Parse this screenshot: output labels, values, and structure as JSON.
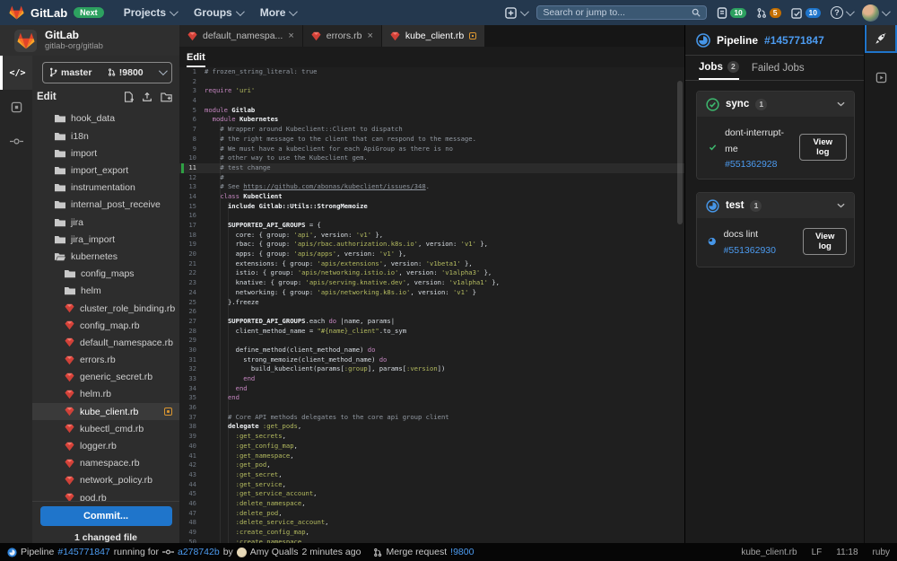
{
  "colors": {
    "blue": "#1f75cb",
    "link": "#4c9bf0",
    "green": "#2da160",
    "success": "#3db96f",
    "running": "#4696e8",
    "orange_badge": "#c26e00",
    "modified": "#d99530",
    "ruby": "#e2453c"
  },
  "navbar": {
    "brand": "GitLab",
    "next_badge": "Next",
    "menus": [
      {
        "label": "Projects"
      },
      {
        "label": "Groups"
      },
      {
        "label": "More"
      }
    ],
    "search": {
      "placeholder": "Search or jump to..."
    },
    "counters": {
      "issues": "10",
      "merge_requests": "5",
      "todos": "10"
    },
    "help": "?"
  },
  "project": {
    "name": "GitLab",
    "path": "gitlab-org/gitlab"
  },
  "branch_bar": {
    "branch": "master",
    "mr": "!9800"
  },
  "explorer": {
    "header": "Edit",
    "commit_label": "Commit...",
    "changed_label": "1 changed file",
    "items": [
      {
        "name": "hook_data",
        "type": "folder",
        "depth": 1
      },
      {
        "name": "i18n",
        "type": "folder",
        "depth": 1
      },
      {
        "name": "import",
        "type": "folder",
        "depth": 1
      },
      {
        "name": "import_export",
        "type": "folder",
        "depth": 1
      },
      {
        "name": "instrumentation",
        "type": "folder",
        "depth": 1
      },
      {
        "name": "internal_post_receive",
        "type": "folder",
        "depth": 1
      },
      {
        "name": "jira",
        "type": "folder",
        "depth": 1
      },
      {
        "name": "jira_import",
        "type": "folder",
        "depth": 1
      },
      {
        "name": "kubernetes",
        "type": "folder-open",
        "depth": 1
      },
      {
        "name": "config_maps",
        "type": "folder",
        "depth": 2
      },
      {
        "name": "helm",
        "type": "folder",
        "depth": 2
      },
      {
        "name": "cluster_role_binding.rb",
        "type": "ruby",
        "depth": 2
      },
      {
        "name": "config_map.rb",
        "type": "ruby",
        "depth": 2
      },
      {
        "name": "default_namespace.rb",
        "type": "ruby",
        "depth": 2
      },
      {
        "name": "errors.rb",
        "type": "ruby",
        "depth": 2
      },
      {
        "name": "generic_secret.rb",
        "type": "ruby",
        "depth": 2
      },
      {
        "name": "helm.rb",
        "type": "ruby",
        "depth": 2
      },
      {
        "name": "kube_client.rb",
        "type": "ruby",
        "depth": 2,
        "selected": true,
        "modified": true
      },
      {
        "name": "kubectl_cmd.rb",
        "type": "ruby",
        "depth": 2
      },
      {
        "name": "logger.rb",
        "type": "ruby",
        "depth": 2
      },
      {
        "name": "namespace.rb",
        "type": "ruby",
        "depth": 2
      },
      {
        "name": "network_policy.rb",
        "type": "ruby",
        "depth": 2
      },
      {
        "name": "pod.rb",
        "type": "ruby",
        "depth": 2
      }
    ]
  },
  "tabs": [
    {
      "label": "default_namespa...",
      "close": true,
      "active": false
    },
    {
      "label": "errors.rb",
      "close": true,
      "active": false
    },
    {
      "label": "kube_client.rb",
      "modified": true,
      "active": true
    }
  ],
  "editor": {
    "mode_tab": "Edit",
    "current_line": 11,
    "changed_lines": [
      11
    ],
    "lines": [
      [
        [
          "c",
          "# frozen_string_literal: true"
        ]
      ],
      [],
      [
        [
          "k",
          "require"
        ],
        [
          "p",
          " "
        ],
        [
          "s",
          "'uri'"
        ]
      ],
      [],
      [
        [
          "k",
          "module"
        ],
        [
          "p",
          " "
        ],
        [
          "b",
          "Gitlab"
        ]
      ],
      [
        [
          "p",
          "  "
        ],
        [
          "k",
          "module"
        ],
        [
          "p",
          " "
        ],
        [
          "b",
          "Kubernetes"
        ]
      ],
      [
        [
          "p",
          "    "
        ],
        [
          "c",
          "# Wrapper around Kubeclient::Client to dispatch"
        ]
      ],
      [
        [
          "p",
          "    "
        ],
        [
          "c",
          "# the right message to the client that can respond to the message."
        ]
      ],
      [
        [
          "p",
          "    "
        ],
        [
          "c",
          "# We must have a kubeclient for each ApiGroup as there is no"
        ]
      ],
      [
        [
          "p",
          "    "
        ],
        [
          "c",
          "# other way to use the Kubeclient gem."
        ]
      ],
      [
        [
          "p",
          "    "
        ],
        [
          "c",
          "# test change"
        ]
      ],
      [
        [
          "p",
          "    "
        ],
        [
          "c",
          "#"
        ]
      ],
      [
        [
          "p",
          "    "
        ],
        [
          "c",
          "# See "
        ],
        [
          "cu",
          "https://github.com/abonas/kubeclient/issues/348"
        ],
        [
          "c",
          "."
        ]
      ],
      [
        [
          "p",
          "    "
        ],
        [
          "k",
          "class"
        ],
        [
          "p",
          " "
        ],
        [
          "b",
          "KubeClient"
        ]
      ],
      [
        [
          "p",
          "      "
        ],
        [
          "b",
          "include"
        ],
        [
          "p",
          " "
        ],
        [
          "b",
          "Gitlab::Utils::StrongMemoize"
        ]
      ],
      [],
      [
        [
          "p",
          "      "
        ],
        [
          "b",
          "SUPPORTED_API_GROUPS"
        ],
        [
          "p",
          " = {"
        ]
      ],
      [
        [
          "p",
          "        core: { group: "
        ],
        [
          "s",
          "'api'"
        ],
        [
          "p",
          ", version: "
        ],
        [
          "s",
          "'v1'"
        ],
        [
          "p",
          " },"
        ]
      ],
      [
        [
          "p",
          "        rbac: { group: "
        ],
        [
          "s",
          "'apis/rbac.authorization.k8s.io'"
        ],
        [
          "p",
          ", version: "
        ],
        [
          "s",
          "'v1'"
        ],
        [
          "p",
          " },"
        ]
      ],
      [
        [
          "p",
          "        apps: { group: "
        ],
        [
          "s",
          "'apis/apps'"
        ],
        [
          "p",
          ", version: "
        ],
        [
          "s",
          "'v1'"
        ],
        [
          "p",
          " },"
        ]
      ],
      [
        [
          "p",
          "        extensions: { group: "
        ],
        [
          "s",
          "'apis/extensions'"
        ],
        [
          "p",
          ", version: "
        ],
        [
          "s",
          "'v1beta1'"
        ],
        [
          "p",
          " },"
        ]
      ],
      [
        [
          "p",
          "        istio: { group: "
        ],
        [
          "s",
          "'apis/networking.istio.io'"
        ],
        [
          "p",
          ", version: "
        ],
        [
          "s",
          "'v1alpha3'"
        ],
        [
          "p",
          " },"
        ]
      ],
      [
        [
          "p",
          "        knative: { group: "
        ],
        [
          "s",
          "'apis/serving.knative.dev'"
        ],
        [
          "p",
          ", version: "
        ],
        [
          "s",
          "'v1alpha1'"
        ],
        [
          "p",
          " },"
        ]
      ],
      [
        [
          "p",
          "        networking: { group: "
        ],
        [
          "s",
          "'apis/networking.k8s.io'"
        ],
        [
          "p",
          ", version: "
        ],
        [
          "s",
          "'v1'"
        ],
        [
          "p",
          " }"
        ]
      ],
      [
        [
          "p",
          "      }.freeze"
        ]
      ],
      [],
      [
        [
          "p",
          "      "
        ],
        [
          "b",
          "SUPPORTED_API_GROUPS"
        ],
        [
          "p",
          ".each "
        ],
        [
          "k",
          "do"
        ],
        [
          "p",
          " |name, params|"
        ]
      ],
      [
        [
          "p",
          "        client_method_name = "
        ],
        [
          "s",
          "\"#{name}_client\""
        ],
        [
          "p",
          ".to_sym"
        ]
      ],
      [],
      [
        [
          "p",
          "        define_method(client_method_name) "
        ],
        [
          "k",
          "do"
        ]
      ],
      [
        [
          "p",
          "          strong_memoize(client_method_name) "
        ],
        [
          "k",
          "do"
        ]
      ],
      [
        [
          "p",
          "            build_kubeclient(params["
        ],
        [
          "s",
          ":group"
        ],
        [
          "p",
          "], params["
        ],
        [
          "s",
          ":version"
        ],
        [
          "p",
          "])"
        ]
      ],
      [
        [
          "p",
          "          "
        ],
        [
          "k",
          "end"
        ]
      ],
      [
        [
          "p",
          "        "
        ],
        [
          "k",
          "end"
        ]
      ],
      [
        [
          "p",
          "      "
        ],
        [
          "k",
          "end"
        ]
      ],
      [],
      [
        [
          "p",
          "      "
        ],
        [
          "c",
          "# Core API methods delegates to the core api group client"
        ]
      ],
      [
        [
          "p",
          "      "
        ],
        [
          "b",
          "delegate"
        ],
        [
          "p",
          " "
        ],
        [
          "s",
          ":get_pods"
        ],
        [
          "p",
          ","
        ]
      ],
      [
        [
          "p",
          "        "
        ],
        [
          "s",
          ":get_secrets"
        ],
        [
          "p",
          ","
        ]
      ],
      [
        [
          "p",
          "        "
        ],
        [
          "s",
          ":get_config_map"
        ],
        [
          "p",
          ","
        ]
      ],
      [
        [
          "p",
          "        "
        ],
        [
          "s",
          ":get_namespace"
        ],
        [
          "p",
          ","
        ]
      ],
      [
        [
          "p",
          "        "
        ],
        [
          "s",
          ":get_pod"
        ],
        [
          "p",
          ","
        ]
      ],
      [
        [
          "p",
          "        "
        ],
        [
          "s",
          ":get_secret"
        ],
        [
          "p",
          ","
        ]
      ],
      [
        [
          "p",
          "        "
        ],
        [
          "s",
          ":get_service"
        ],
        [
          "p",
          ","
        ]
      ],
      [
        [
          "p",
          "        "
        ],
        [
          "s",
          ":get_service_account"
        ],
        [
          "p",
          ","
        ]
      ],
      [
        [
          "p",
          "        "
        ],
        [
          "s",
          ":delete_namespace"
        ],
        [
          "p",
          ","
        ]
      ],
      [
        [
          "p",
          "        "
        ],
        [
          "s",
          ":delete_pod"
        ],
        [
          "p",
          ","
        ]
      ],
      [
        [
          "p",
          "        "
        ],
        [
          "s",
          ":delete_service_account"
        ],
        [
          "p",
          ","
        ]
      ],
      [
        [
          "p",
          "        "
        ],
        [
          "s",
          ":create_config_map"
        ],
        [
          "p",
          ","
        ]
      ],
      [
        [
          "p",
          "        "
        ],
        [
          "s",
          ":create_namespace"
        ],
        [
          "p",
          ","
        ]
      ]
    ]
  },
  "panel": {
    "title": "Pipeline",
    "id": "#145771847",
    "tabs": [
      {
        "label": "Jobs",
        "count": "2",
        "active": true
      },
      {
        "label": "Failed Jobs",
        "active": false
      }
    ],
    "stages": [
      {
        "name": "sync",
        "count": "1",
        "status": "success",
        "jobs": [
          {
            "name": "dont-interrupt-me",
            "id": "#551362928",
            "status": "success",
            "action": "View log",
            "stack": true
          }
        ]
      },
      {
        "name": "test",
        "count": "1",
        "status": "running",
        "jobs": [
          {
            "name": "docs lint",
            "id": "#551362930",
            "status": "running",
            "action": "View log",
            "stack": false
          }
        ]
      }
    ]
  },
  "status": {
    "pipeline_label": "Pipeline",
    "pipeline_id": "#145771847",
    "running_for": "running for",
    "commit": "a278742b",
    "by": "by",
    "author": "Amy Qualls",
    "time": "2 minutes ago",
    "mr_label": "Merge request",
    "mr_id": "!9800",
    "file": "kube_client.rb",
    "eol": "LF",
    "cursor": "11:18",
    "lang": "ruby"
  }
}
